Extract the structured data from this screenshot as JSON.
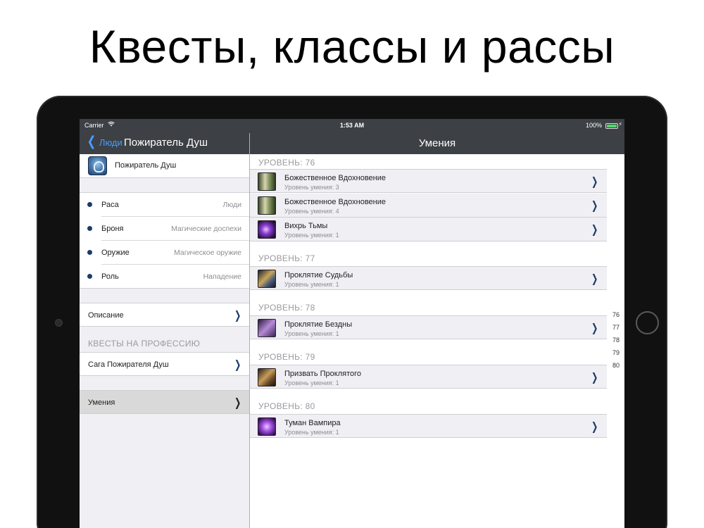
{
  "promo": {
    "title": "Квесты, классы и рассы"
  },
  "status_bar": {
    "carrier": "Carrier",
    "wifi_icon": "wifi-icon",
    "time": "1:53 AM",
    "battery_percent": "100%",
    "battery_level": 1.0
  },
  "nav_left": {
    "back_label": "Люди",
    "title": "Пожиратель Душ"
  },
  "nav_right": {
    "title": "Умения"
  },
  "left": {
    "class_name": "Пожиратель Душ",
    "attributes": [
      {
        "label": "Раса",
        "value": "Люди"
      },
      {
        "label": "Броня",
        "value": "Магические доспехи"
      },
      {
        "label": "Оружие",
        "value": "Магическое оружие"
      },
      {
        "label": "Роль",
        "value": "Нападение"
      }
    ],
    "description_label": "Описание",
    "quests_header": "КВЕСТЫ НА ПРОФЕССИЮ",
    "quest_label": "Сага Пожирателя Душ",
    "skills_label": "Умения"
  },
  "right": {
    "levels": [
      {
        "header": "УРОВЕНЬ: 76",
        "skills": [
          {
            "name": "Божественное Вдохновение",
            "level": "Уровень умения: 3"
          },
          {
            "name": "Божественное Вдохновение",
            "level": "Уровень умения: 4"
          },
          {
            "name": "Вихрь Тьмы",
            "level": "Уровень умения: 1"
          }
        ]
      },
      {
        "header": "УРОВЕНЬ: 77",
        "skills": [
          {
            "name": "Проклятие Судьбы",
            "level": "Уровень умения: 1"
          }
        ]
      },
      {
        "header": "УРОВЕНЬ: 78",
        "skills": [
          {
            "name": "Проклятие Бездны",
            "level": "Уровень умения: 1"
          }
        ]
      },
      {
        "header": "УРОВЕНЬ: 79",
        "skills": [
          {
            "name": "Призвать Проклятого",
            "level": "Уровень умения: 1"
          }
        ]
      },
      {
        "header": "УРОВЕНЬ: 80",
        "skills": [
          {
            "name": "Туман Вампира",
            "level": "Уровень умения: 1"
          }
        ]
      }
    ],
    "index": [
      "76",
      "77",
      "78",
      "79",
      "80"
    ]
  }
}
